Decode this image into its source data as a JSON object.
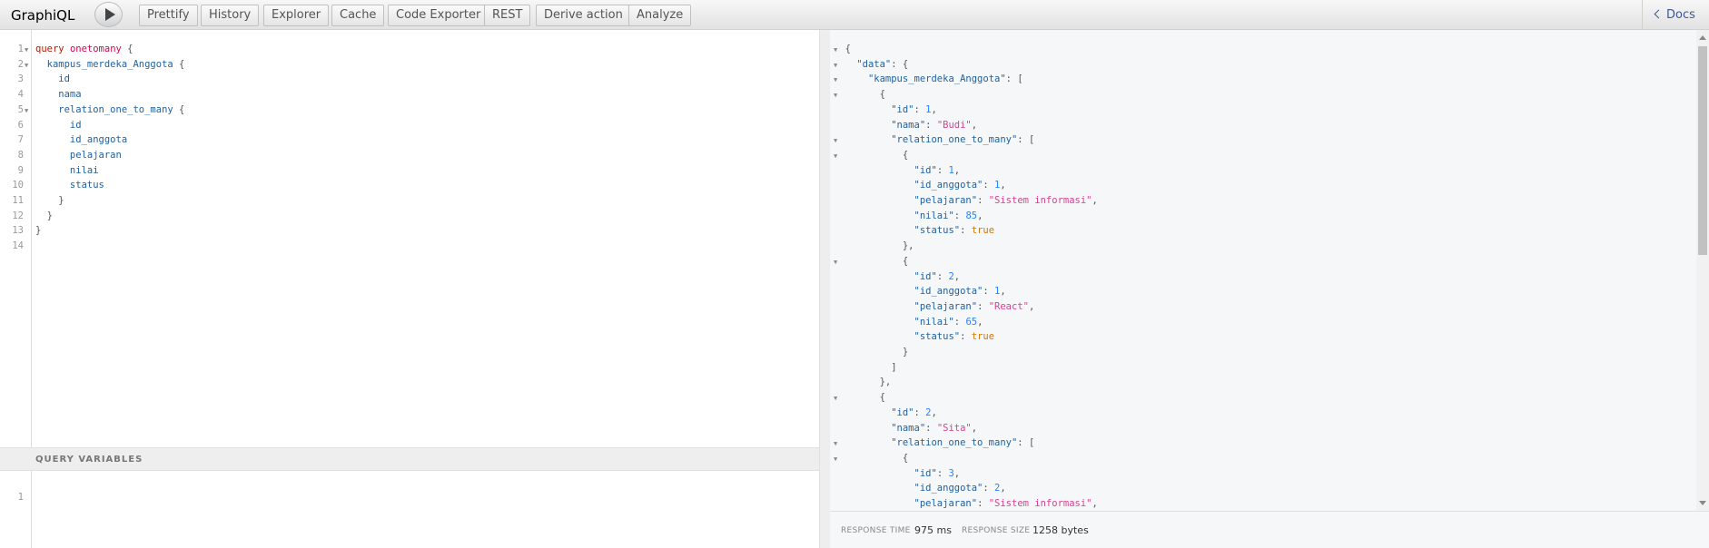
{
  "app": {
    "title": "GraphiQL"
  },
  "toolbar": {
    "run_icon": "play-icon",
    "buttons": [
      "Prettify",
      "History",
      "Explorer",
      "Cache",
      "Code Exporter",
      "REST",
      "Derive action",
      "Analyze"
    ],
    "docs_label": "Docs"
  },
  "query_editor": {
    "line_numbers": [
      "1",
      "2",
      "3",
      "4",
      "5",
      "6",
      "7",
      "8",
      "9",
      "10",
      "11",
      "12",
      "13",
      "14"
    ],
    "lines": [
      "query onetomany {",
      "  kampus_merdeka_Anggota {",
      "    id",
      "    nama",
      "    relation_one_to_many {",
      "      id",
      "      id_anggota",
      "      pelajaran",
      "      nilai",
      "      status",
      "    }",
      "  }",
      "}",
      ""
    ]
  },
  "variables": {
    "header": "QUERY VARIABLES",
    "line_numbers": [
      "1"
    ]
  },
  "result": {
    "lines": [
      "{",
      "  \"data\": {",
      "    \"kampus_merdeka_Anggota\": [",
      "      {",
      "        \"id\": 1,",
      "        \"nama\": \"Budi\",",
      "        \"relation_one_to_many\": [",
      "          {",
      "            \"id\": 1,",
      "            \"id_anggota\": 1,",
      "            \"pelajaran\": \"Sistem informasi\",",
      "            \"nilai\": 85,",
      "            \"status\": true",
      "          },",
      "          {",
      "            \"id\": 2,",
      "            \"id_anggota\": 1,",
      "            \"pelajaran\": \"React\",",
      "            \"nilai\": 65,",
      "            \"status\": true",
      "          }",
      "        ]",
      "      },",
      "      {",
      "        \"id\": 2,",
      "        \"nama\": \"Sita\",",
      "        \"relation_one_to_many\": [",
      "          {",
      "            \"id\": 3,",
      "            \"id_anggota\": 2,",
      "            \"pelajaran\": \"Sistem informasi\","
    ]
  },
  "footer": {
    "response_time_label": "RESPONSE TIME",
    "response_time_value": "975 ms",
    "response_size_label": "RESPONSE SIZE",
    "response_size_value": "1258 bytes"
  }
}
